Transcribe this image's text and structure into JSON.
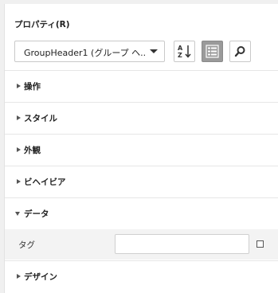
{
  "panel": {
    "title": "プロパティ(R)",
    "selector_value": "GroupHeader1 (グループ ヘ...",
    "buttons": {
      "sort": "sort-alphabetical-icon",
      "categorized": "categorized-view-icon",
      "search": "search-icon"
    }
  },
  "sections": [
    {
      "label": "操作",
      "expanded": false
    },
    {
      "label": "スタイル",
      "expanded": false
    },
    {
      "label": "外観",
      "expanded": false
    },
    {
      "label": "ビヘイビア",
      "expanded": false
    },
    {
      "label": "データ",
      "expanded": true
    },
    {
      "label": "デザイン",
      "expanded": false
    }
  ],
  "data_section": {
    "property_label": "タグ",
    "property_value": ""
  },
  "colors": {
    "active_button": "#9a9a9a",
    "row_highlight": "#f3f3f3"
  }
}
